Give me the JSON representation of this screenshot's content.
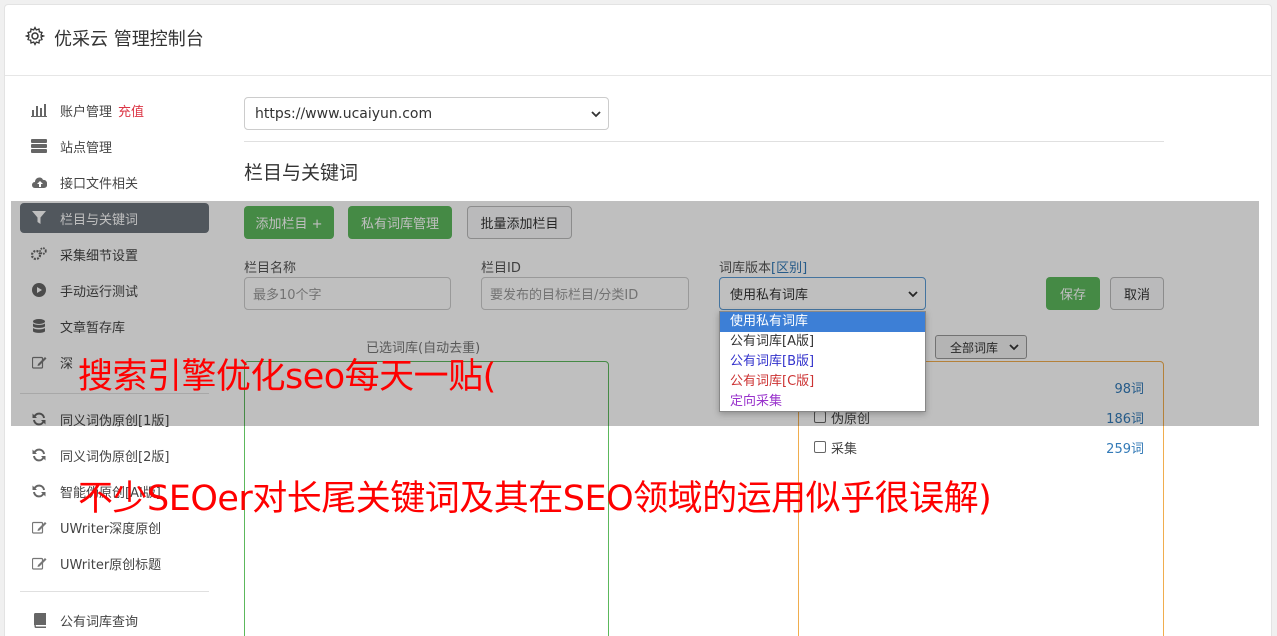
{
  "header": {
    "title": "优采云 管理控制台"
  },
  "sidebar": {
    "items": [
      {
        "label": "账户管理",
        "badge": "充值",
        "icon": "chart-icon"
      },
      {
        "label": "站点管理",
        "icon": "server-icon"
      },
      {
        "label": "接口文件相关",
        "icon": "cloud-upload-icon"
      },
      {
        "label": "栏目与关键词",
        "icon": "filter-icon",
        "active": true
      },
      {
        "label": "采集细节设置",
        "icon": "gears-icon"
      },
      {
        "label": "手动运行测试",
        "icon": "play-icon"
      },
      {
        "label": "文章暂存库",
        "icon": "database-icon"
      },
      {
        "label": "深",
        "icon": "edit-icon"
      },
      {
        "label": "同义词伪原创[1版]",
        "icon": "refresh-icon"
      },
      {
        "label": "同义词伪原创[2版]",
        "icon": "refresh-icon"
      },
      {
        "label": "智能伪原创[AI版]",
        "icon": "refresh-icon"
      },
      {
        "label": "UWriter深度原创",
        "icon": "edit-icon"
      },
      {
        "label": "UWriter原创标题",
        "icon": "edit-icon"
      },
      {
        "label": "公有词库查询",
        "icon": "book-icon"
      }
    ]
  },
  "main": {
    "site_select": "https://www.ucaiyun.com",
    "section_title": "栏目与关键词",
    "buttons": {
      "add_column": "添加栏目 +",
      "private_lib": "私有词库管理",
      "batch_add": "批量添加栏目",
      "save": "保存",
      "cancel": "取消"
    },
    "fields": {
      "name_label": "栏目名称",
      "name_placeholder": "最多10个字",
      "id_label": "栏目ID",
      "id_placeholder": "要发布的目标栏目/分类ID",
      "version_label": "词库版本",
      "version_link": "[区别]",
      "version_value": "使用私有词库"
    },
    "dropdown_options": [
      {
        "label": "使用私有词库",
        "color": "#ffffff"
      },
      {
        "label": "公有词库[A版]",
        "color": "#333333"
      },
      {
        "label": "公有词库[B版]",
        "color": "#3333cc"
      },
      {
        "label": "公有词库[C版]",
        "color": "#cc3333"
      },
      {
        "label": "定向采集",
        "color": "#9933cc"
      }
    ],
    "selected_lib_label": "已选词库(自动去重)",
    "lib_filter": "全部词库",
    "lib_rows": [
      {
        "name": "",
        "count": "98词"
      },
      {
        "name": "伪原创",
        "count": "186词"
      },
      {
        "name": "采集",
        "count": "259词"
      }
    ]
  },
  "watermark": {
    "line1": "搜索引擎优化seo每天一贴(",
    "line2": "不少SEOer对长尾关键词及其在SEO领域的运用似乎很误解)"
  }
}
